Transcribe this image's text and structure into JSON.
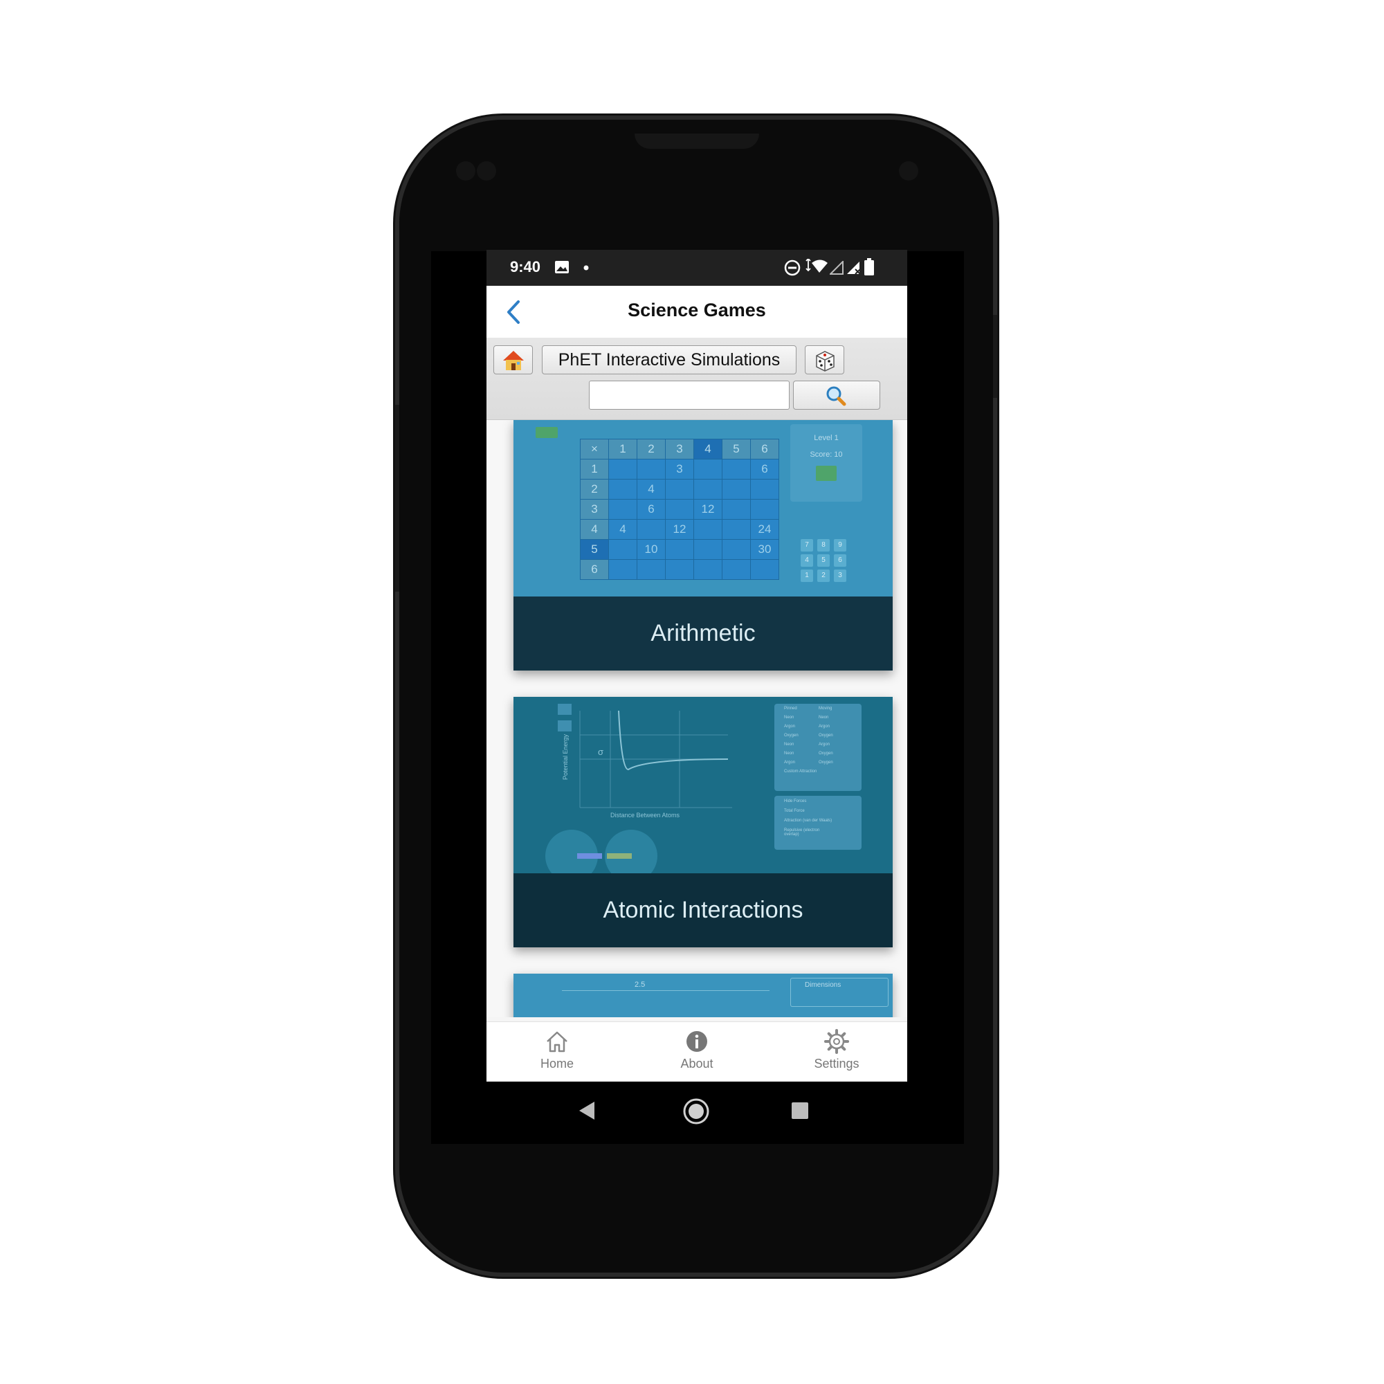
{
  "status_bar": {
    "time": "9:40"
  },
  "app_bar": {
    "title": "Science Games"
  },
  "toolbar": {
    "source_label": "PhET Interactive Simulations",
    "search_value": ""
  },
  "cards": [
    {
      "title": "Arithmetic",
      "footer_title": "Arithmetic",
      "level_text": "Level 1",
      "score_text": "Score: 10",
      "grid_header": [
        "×",
        "1",
        "2",
        "3",
        "4",
        "5",
        "6"
      ],
      "grid_rows": [
        [
          "1",
          "",
          "",
          "3",
          "",
          "",
          "6"
        ],
        [
          "2",
          "",
          "4",
          "",
          "",
          "",
          ""
        ],
        [
          "3",
          "",
          "6",
          "",
          "12",
          "",
          ""
        ],
        [
          "4",
          "4",
          "",
          "12",
          "",
          "",
          "24"
        ],
        [
          "5",
          "",
          "10",
          "",
          "",
          "",
          "30"
        ],
        [
          "6",
          "",
          "",
          "",
          "",
          "",
          ""
        ]
      ],
      "keypad": [
        "7",
        "8",
        "9",
        "4",
        "5",
        "6",
        "1",
        "2",
        "3"
      ],
      "answer_row": [
        "5",
        "4"
      ]
    },
    {
      "title": "Atomic Interactions",
      "footer_title": "Atomic Interactions",
      "graph_ylabel": "Potential Energy",
      "graph_xlabel": "Distance Between Atoms",
      "sigma": "σ",
      "panel_items": [
        "Pinned",
        "Moving",
        "Neon",
        "Neon",
        "Argon",
        "Argon",
        "Oxygen",
        "Oxygen",
        "Neon",
        "Argon",
        "Neon",
        "Oxygen",
        "Argon",
        "Oxygen",
        "Custom Attraction"
      ],
      "force_items": [
        "Hide Forces",
        "Total Force",
        "Attraction (van der Waals)",
        "Repulsive (electron overlap)"
      ]
    },
    {
      "title": "",
      "top_value": "2.5",
      "panel_label": "Dimensions"
    }
  ],
  "bottom_nav": [
    {
      "label": "Home",
      "icon": "home-icon"
    },
    {
      "label": "About",
      "icon": "info-icon"
    },
    {
      "label": "Settings",
      "icon": "gear-icon"
    }
  ],
  "colors": {
    "accent_blue": "#2f7fc6",
    "card1_bg": "#3a94bd",
    "card2_bg": "#1b6d87",
    "status_bar": "#212121"
  }
}
